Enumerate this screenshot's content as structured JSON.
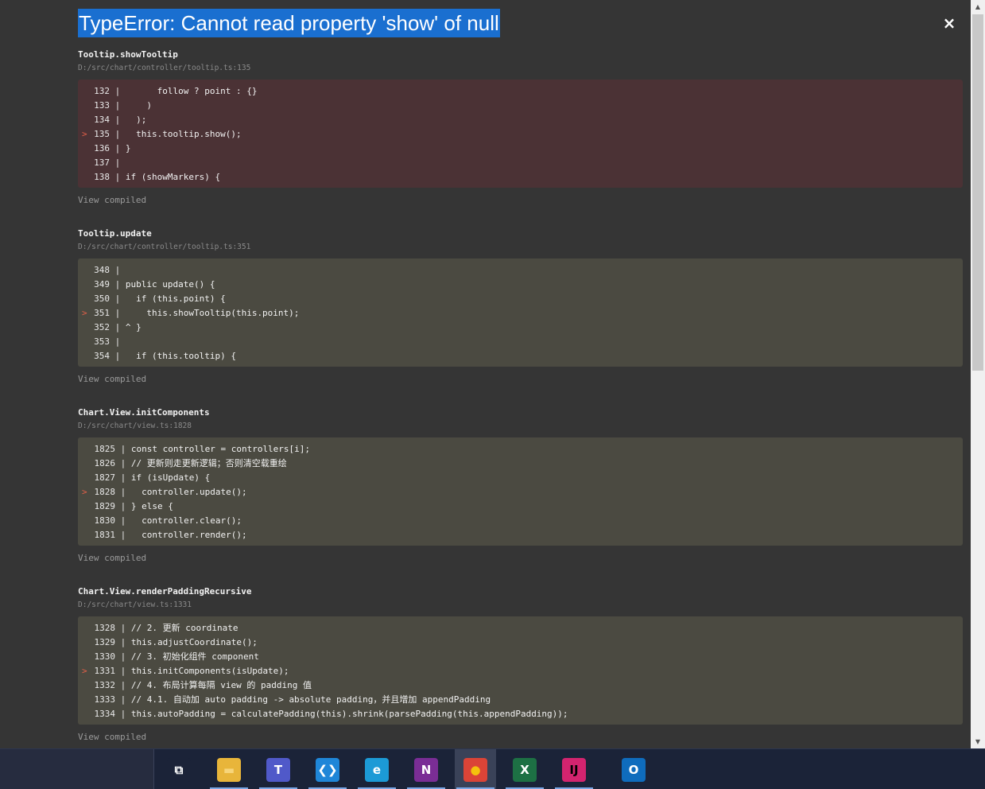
{
  "error": {
    "title": "TypeError: Cannot read property 'show' of null",
    "close_glyph": "×"
  },
  "frames": [
    {
      "function": "Tooltip.showTooltip",
      "file": "D:/src/chart/controller/tooltip.ts:135",
      "style": "err",
      "lines": [
        {
          "num": "132",
          "marker": "",
          "code": "      follow ? point : {}"
        },
        {
          "num": "133",
          "marker": "",
          "code": "    )"
        },
        {
          "num": "134",
          "marker": "",
          "code": "  );"
        },
        {
          "num": "135",
          "marker": ">",
          "code": "  this.tooltip.show();"
        },
        {
          "num": "136",
          "marker": "",
          "code": "}"
        },
        {
          "num": "137",
          "marker": "",
          "code": ""
        },
        {
          "num": "138",
          "marker": "",
          "code": "if (showMarkers) {"
        }
      ],
      "view_compiled": "View compiled"
    },
    {
      "function": "Tooltip.update",
      "file": "D:/src/chart/controller/tooltip.ts:351",
      "style": "ok",
      "lines": [
        {
          "num": "348",
          "marker": "",
          "code": ""
        },
        {
          "num": "349",
          "marker": "",
          "code": "public update() {"
        },
        {
          "num": "350",
          "marker": "",
          "code": "  if (this.point) {"
        },
        {
          "num": "351",
          "marker": ">",
          "code": "    this.showTooltip(this.point);"
        },
        {
          "num": "352",
          "marker": "",
          "code": "^ }"
        },
        {
          "num": "353",
          "marker": "",
          "code": ""
        },
        {
          "num": "354",
          "marker": "",
          "code": "  if (this.tooltip) {"
        }
      ],
      "view_compiled": "View compiled"
    },
    {
      "function": "Chart.View.initComponents",
      "file": "D:/src/chart/view.ts:1828",
      "style": "ok",
      "lines": [
        {
          "num": "1825",
          "marker": "",
          "code": "const controller = controllers[i];"
        },
        {
          "num": "1826",
          "marker": "",
          "code": "// 更新则走更新逻辑；否则清空载重绘"
        },
        {
          "num": "1827",
          "marker": "",
          "code": "if (isUpdate) {"
        },
        {
          "num": "1828",
          "marker": ">",
          "code": "  controller.update();"
        },
        {
          "num": "1829",
          "marker": "",
          "code": "} else {"
        },
        {
          "num": "1830",
          "marker": "",
          "code": "  controller.clear();"
        },
        {
          "num": "1831",
          "marker": "",
          "code": "  controller.render();"
        }
      ],
      "view_compiled": "View compiled"
    },
    {
      "function": "Chart.View.renderPaddingRecursive",
      "file": "D:/src/chart/view.ts:1331",
      "style": "ok",
      "lines": [
        {
          "num": "1328",
          "marker": "",
          "code": "// 2. 更新 coordinate"
        },
        {
          "num": "1329",
          "marker": "",
          "code": "this.adjustCoordinate();"
        },
        {
          "num": "1330",
          "marker": "",
          "code": "// 3. 初始化组件 component"
        },
        {
          "num": "1331",
          "marker": ">",
          "code": "this.initComponents(isUpdate);"
        },
        {
          "num": "1332",
          "marker": "",
          "code": "// 4. 布局计算每隔 view 的 padding 值"
        },
        {
          "num": "1333",
          "marker": "",
          "code": "// 4.1. 自动加 auto padding -> absolute padding，并且增加 appendPadding"
        },
        {
          "num": "1334",
          "marker": "",
          "code": "this.autoPadding = calculatePadding(this).shrink(parsePadding(this.appendPadding));"
        }
      ],
      "view_compiled": "View compiled"
    }
  ],
  "scrollbar": {
    "up_glyph": "▲",
    "down_glyph": "▼"
  },
  "taskbar": {
    "items": [
      {
        "name": "task-view-icon",
        "glyph": "⧉",
        "bg": "#1b2338",
        "fg": "#ffffff",
        "active": false
      },
      {
        "name": "file-explorer-icon",
        "glyph": "▬",
        "bg": "#e8b53a",
        "fg": "#f7d57a",
        "active": false
      },
      {
        "name": "teams-icon",
        "glyph": "T",
        "bg": "#5059c9",
        "fg": "#ffffff",
        "active": false
      },
      {
        "name": "vscode-icon",
        "glyph": "❮❯",
        "bg": "#1f86d8",
        "fg": "#ffffff",
        "active": false
      },
      {
        "name": "edge-icon",
        "glyph": "e",
        "bg": "#1c9ad6",
        "fg": "#ffffff",
        "active": false
      },
      {
        "name": "onenote-icon",
        "glyph": "N",
        "bg": "#7a2d95",
        "fg": "#ffffff",
        "active": false
      },
      {
        "name": "chrome-icon",
        "glyph": "●",
        "bg": "#db4437",
        "fg": "#f4c20d",
        "active": true
      },
      {
        "name": "excel-icon",
        "glyph": "X",
        "bg": "#1d7044",
        "fg": "#ffffff",
        "active": false
      },
      {
        "name": "intellij-icon",
        "glyph": "IJ",
        "bg": "#d3246f",
        "fg": "#000000",
        "active": false
      },
      {
        "name": "outlook-icon",
        "glyph": "O",
        "bg": "#0f6cbd",
        "fg": "#ffffff",
        "active": false
      }
    ]
  }
}
